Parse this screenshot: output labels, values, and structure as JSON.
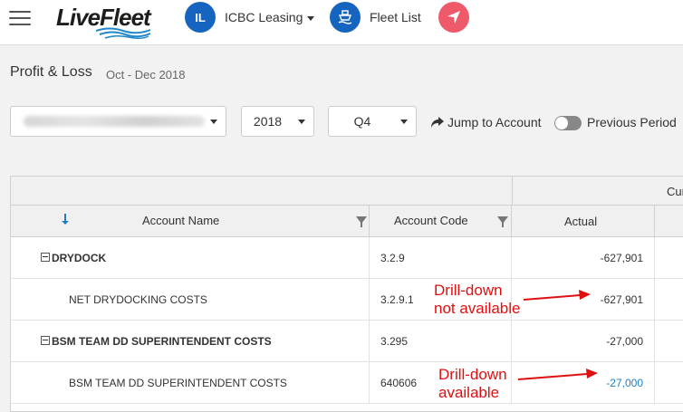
{
  "header": {
    "brand": "LiveFleet",
    "company_initials": "IL",
    "company_name": "ICBC Leasing",
    "fleet_list_label": "Fleet List"
  },
  "page": {
    "title": "Profit & Loss",
    "period": "Oct - Dec 2018"
  },
  "filters": {
    "year": "2018",
    "quarter": "Q4",
    "jump_label": "Jump to Account",
    "previous_period_label": "Previous Period"
  },
  "grid": {
    "group_header_partial": "Cur",
    "columns": {
      "name": "Account Name",
      "code": "Account Code",
      "actual": "Actual"
    },
    "rows": [
      {
        "name": "DRYDOCK",
        "code": "3.2.9",
        "actual": "-627,901"
      },
      {
        "name": "NET DRYDOCKING COSTS",
        "code": "3.2.9.1",
        "actual": "-627,901"
      },
      {
        "name": "BSM TEAM DD SUPERINTENDENT COSTS",
        "code": "3.295",
        "actual": "-27,000"
      },
      {
        "name": "BSM TEAM DD SUPERINTENDENT COSTS",
        "code": "640606",
        "actual": "-27,000"
      }
    ]
  },
  "annotations": {
    "not_available_line1": "Drill-down",
    "not_available_line2": "not available",
    "available_line1": "Drill-down",
    "available_line2": "available"
  },
  "colors": {
    "brand_blue": "#1565c0",
    "nav_red": "#ef5a6a",
    "link_blue": "#1e7fbf",
    "annotation_red": "#e01010"
  }
}
